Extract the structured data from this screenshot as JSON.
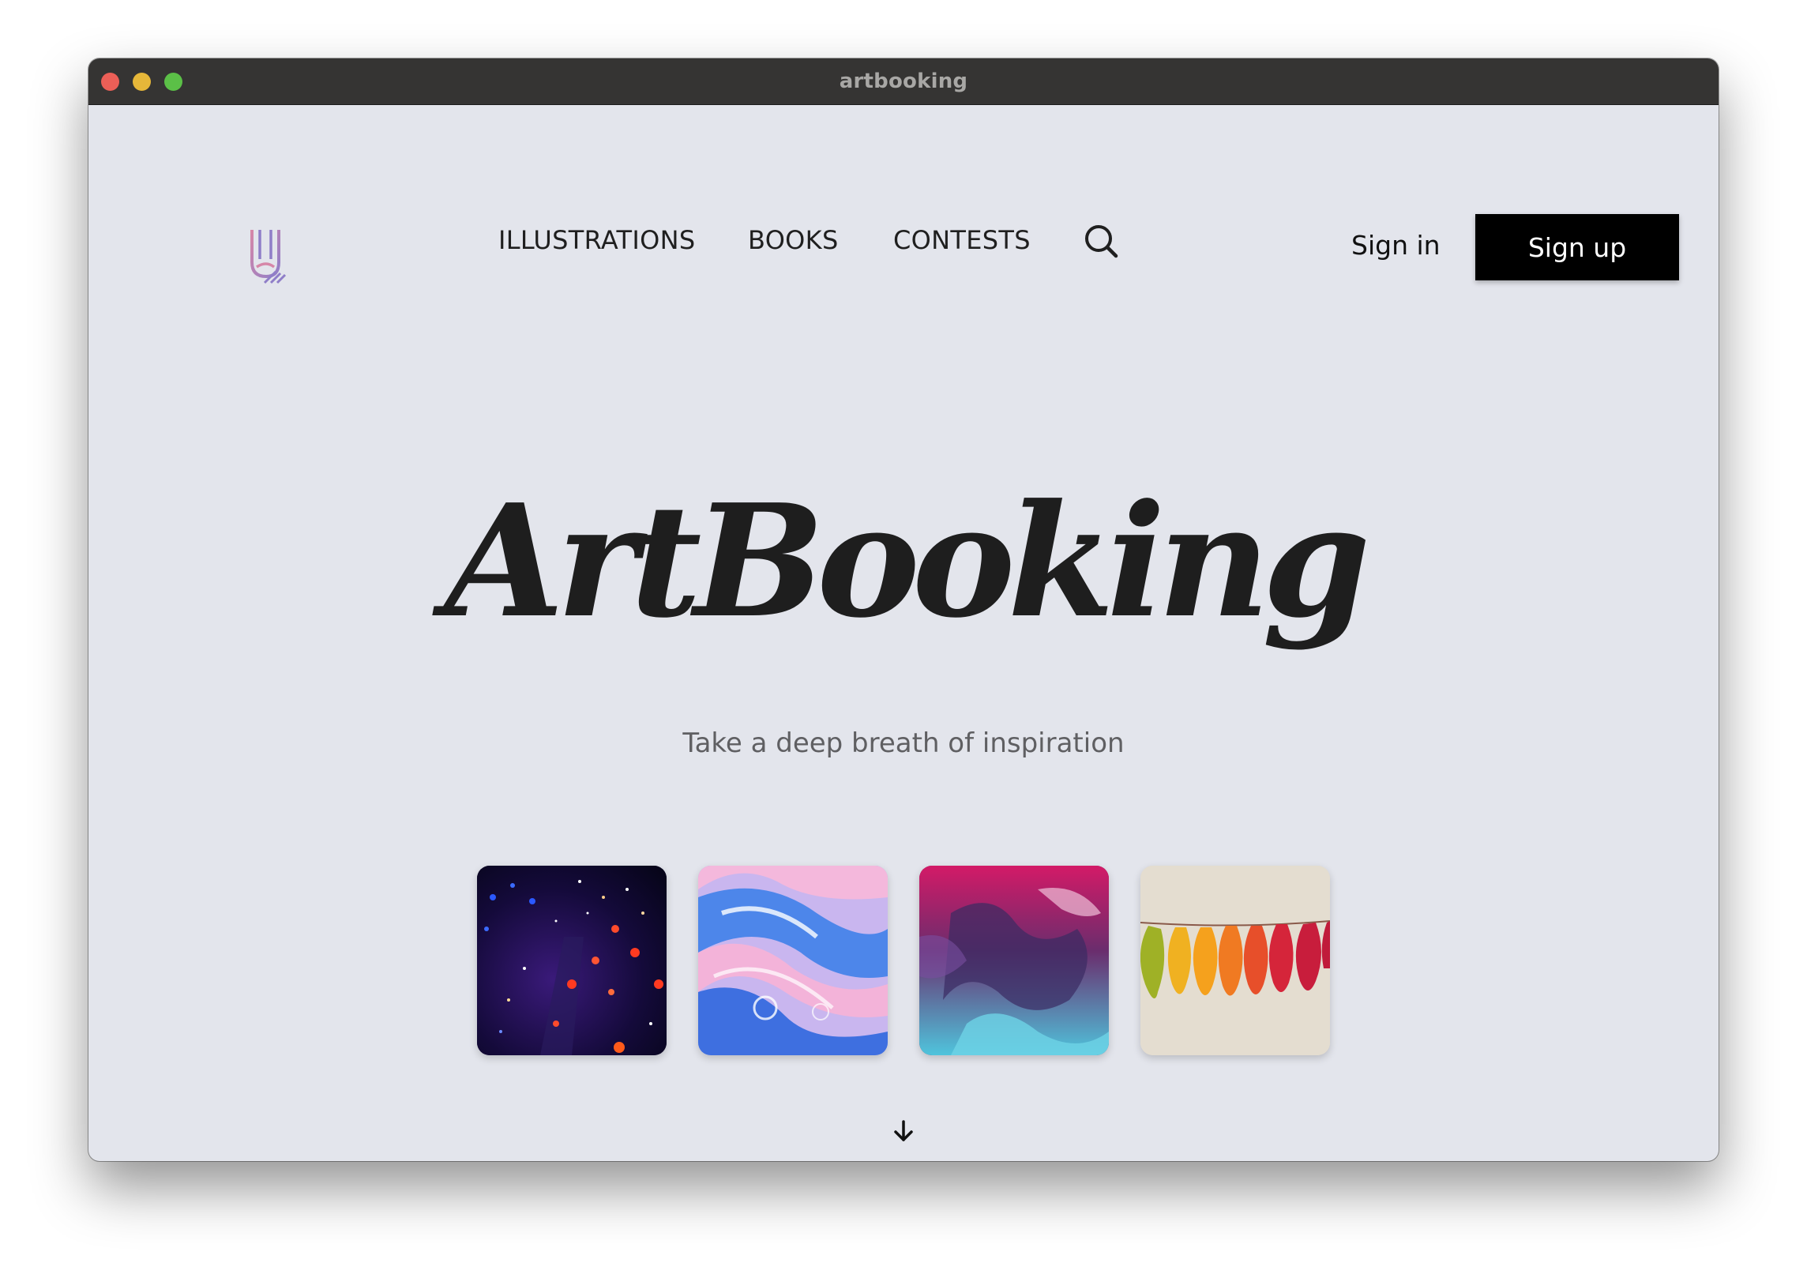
{
  "window": {
    "title": "artbooking"
  },
  "header": {
    "logo_icon": "pencil-logo-icon",
    "nav": [
      {
        "label": "ILLUSTRATIONS"
      },
      {
        "label": "BOOKS"
      },
      {
        "label": "CONTESTS"
      }
    ],
    "search_icon": "search-icon",
    "signin_label": "Sign in",
    "signup_label": "Sign up"
  },
  "hero": {
    "title": "ArtBooking",
    "subtitle": "Take a deep breath of inspiration"
  },
  "gallery": [
    {
      "icon": "space-lights-thumbnail"
    },
    {
      "icon": "blue-pink-fluid-thumbnail"
    },
    {
      "icon": "pink-teal-smoke-thumbnail"
    },
    {
      "icon": "autumn-leaves-thumbnail"
    }
  ],
  "scroll_icon": "arrow-down-icon",
  "colors": {
    "background": "#e3e5ec",
    "titlebar": "#353433",
    "button": "#000000",
    "text": "#1e1e1e",
    "subtitle": "#5f5f62",
    "logo_pink": "#d687a8",
    "logo_purple": "#8f7ec8"
  }
}
